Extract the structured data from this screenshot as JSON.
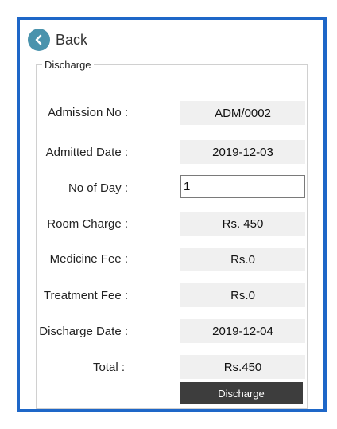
{
  "nav": {
    "back_label": "Back"
  },
  "group_title": "Discharge",
  "fields": {
    "admission_no": {
      "label": "Admission No :",
      "value": "ADM/0002"
    },
    "admitted_date": {
      "label": "Admitted Date :",
      "value": "2019-12-03"
    },
    "no_of_day": {
      "label": "No of Day :",
      "value": "1"
    },
    "room_charge": {
      "label": "Room Charge :",
      "value": "Rs. 450"
    },
    "medicine_fee": {
      "label": "Medicine Fee :",
      "value": "Rs.0"
    },
    "treatment_fee": {
      "label": "Treatment Fee :",
      "value": "Rs.0"
    },
    "discharge_date": {
      "label": "Discharge Date :",
      "value": "2019-12-04"
    },
    "total": {
      "label": "Total :",
      "value": "Rs.450"
    }
  },
  "actions": {
    "discharge_label": "Discharge"
  },
  "colors": {
    "frame": "#1e67c8",
    "back_icon": "#4a93ad",
    "button": "#3d3d3d",
    "value_bg": "#f0f0f0"
  }
}
